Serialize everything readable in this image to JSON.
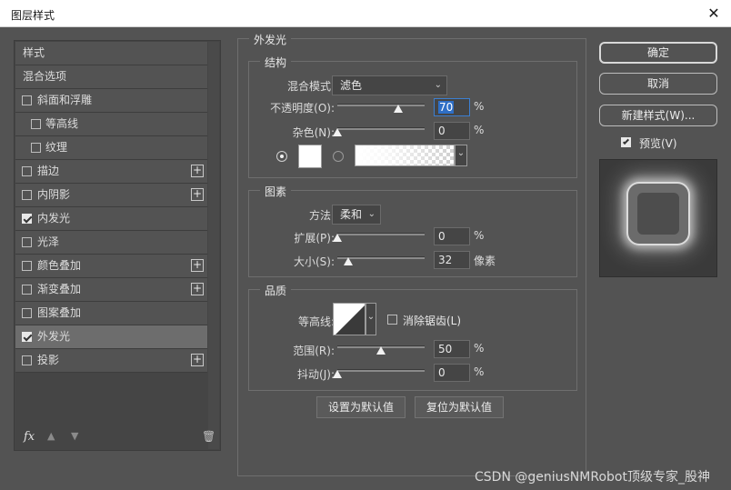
{
  "window": {
    "title": "图层样式",
    "close_glyph": "✕"
  },
  "left_panel": {
    "items": [
      {
        "label": "样式",
        "kind": "head"
      },
      {
        "label": "混合选项",
        "kind": "head"
      },
      {
        "label": "斜面和浮雕",
        "checked": false
      },
      {
        "label": "等高线",
        "checked": false,
        "sub": true
      },
      {
        "label": "纹理",
        "checked": false,
        "sub": true
      },
      {
        "label": "描边",
        "checked": false,
        "plus": true
      },
      {
        "label": "内阴影",
        "checked": false,
        "plus": true
      },
      {
        "label": "内发光",
        "checked": true
      },
      {
        "label": "光泽",
        "checked": false
      },
      {
        "label": "颜色叠加",
        "checked": false,
        "plus": true
      },
      {
        "label": "渐变叠加",
        "checked": false,
        "plus": true
      },
      {
        "label": "图案叠加",
        "checked": false
      },
      {
        "label": "外发光",
        "checked": true,
        "selected": true
      },
      {
        "label": "投影",
        "checked": false,
        "plus": true
      }
    ],
    "footer": {
      "fx": "fx",
      "up": "▲",
      "down": "▼",
      "trash": "🗑"
    }
  },
  "outer_glow": {
    "title": "外发光",
    "structure": {
      "title": "结构",
      "blend_mode_label": "混合模式:",
      "blend_mode_value": "滤色",
      "opacity_label": "不透明度(O):",
      "opacity_value": "70",
      "opacity_fraction": 0.7,
      "noise_label": "杂色(N):",
      "noise_value": "0",
      "noise_fraction": 0.0,
      "percent": "%"
    },
    "elements": {
      "title": "图素",
      "technique_label": "方法:",
      "technique_value": "柔和",
      "spread_label": "扩展(P):",
      "spread_value": "0",
      "spread_fraction": 0.0,
      "size_label": "大小(S):",
      "size_value": "32",
      "size_fraction": 0.13,
      "size_unit": "像素",
      "percent": "%"
    },
    "quality": {
      "title": "品质",
      "contour_label": "等高线:",
      "antialias_label": "消除锯齿(L)",
      "range_label": "范围(R):",
      "range_value": "50",
      "range_fraction": 0.5,
      "jitter_label": "抖动(J):",
      "jitter_value": "0",
      "jitter_fraction": 0.0,
      "percent": "%"
    },
    "buttons": {
      "make_default": "设置为默认值",
      "reset_default": "复位为默认值"
    }
  },
  "right_panel": {
    "ok": "确定",
    "cancel": "取消",
    "new_style": "新建样式(W)...",
    "preview_label": "预览(V)",
    "preview_checked": true
  },
  "watermark": "CSDN @geniusNMRobot顶级专家_股神"
}
